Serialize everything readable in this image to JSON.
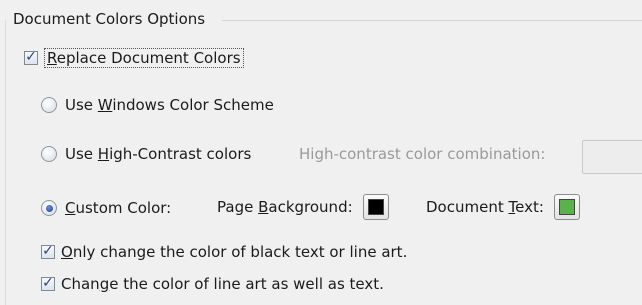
{
  "group": {
    "title": "Document Colors Options"
  },
  "replace": {
    "label_pre": "",
    "label_acc": "R",
    "label_post": "eplace Document Colors",
    "checked": true
  },
  "windows_scheme": {
    "label_pre": "Use ",
    "label_acc": "W",
    "label_post": "indows Color Scheme",
    "selected": false
  },
  "high_contrast": {
    "label_pre": "Use ",
    "label_acc": "H",
    "label_post": "igh-Contrast colors",
    "selected": false,
    "combination_label": "High-contrast color combination:",
    "combination_value": ""
  },
  "custom_color": {
    "label_pre": "",
    "label_acc": "C",
    "label_post": "ustom Color:",
    "selected": true,
    "page_bg_pre": "Page ",
    "page_bg_acc": "B",
    "page_bg_post": "ackground:",
    "page_bg_color": "#000000",
    "doc_text_pre": "Document ",
    "doc_text_acc": "T",
    "doc_text_post": "ext:",
    "doc_text_color": "#5ab24a"
  },
  "only_black": {
    "label_pre": "",
    "label_acc": "O",
    "label_post": "nly change the color of black text or line art.",
    "checked": true
  },
  "line_art": {
    "label_pre": "Chan",
    "label_acc": "g",
    "label_post": "e the color of line art as well as text.",
    "checked": true
  },
  "colors": {
    "background": "#f0f0f0",
    "text": "#1b1b1b",
    "disabled_text": "#9a9a9a",
    "check_accent": "#2a3f8f"
  },
  "icons": {
    "checkbox": "check-mark",
    "radio": "radio-dot"
  }
}
